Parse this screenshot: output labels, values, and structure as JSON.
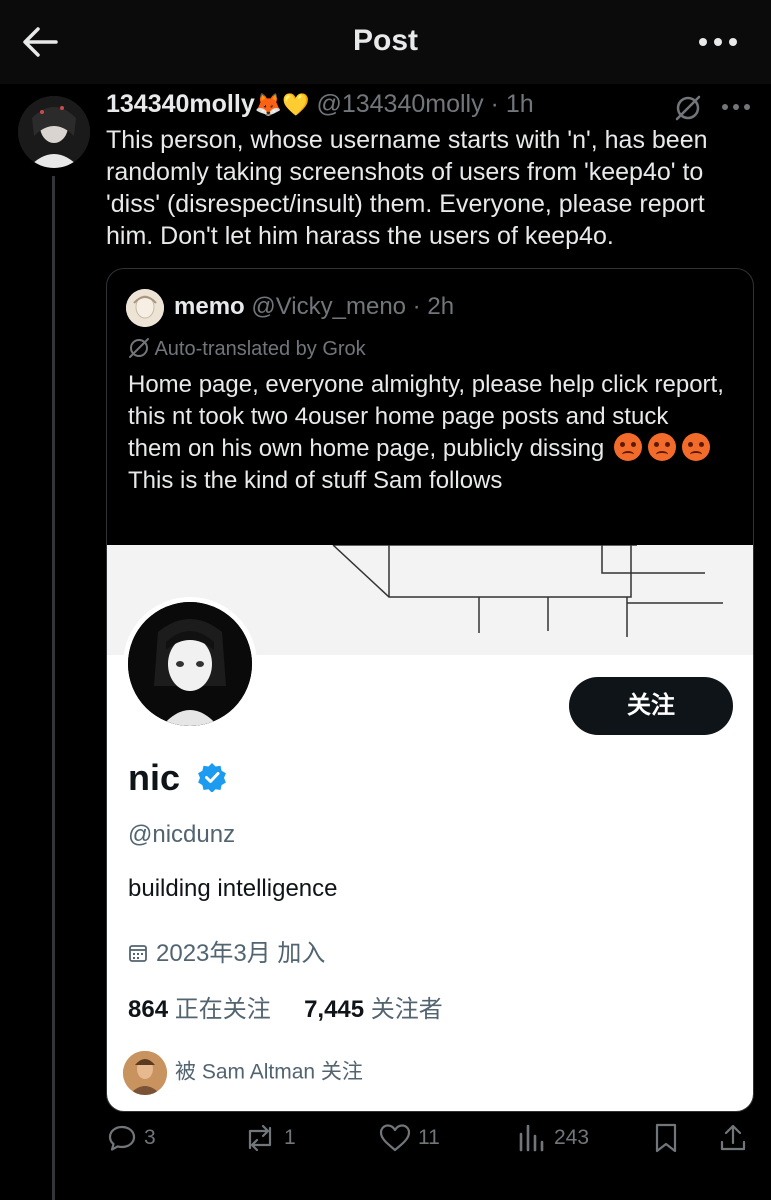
{
  "header": {
    "title": "Post",
    "back_icon": "arrow-left-icon",
    "more_icon": "more-horizontal-icon"
  },
  "post": {
    "author_name": "134340molly",
    "author_emojis": "🦊💛",
    "handle": "@134340molly",
    "time": "1h",
    "text": "This person, whose username starts with 'n', has been randomly taking screenshots of users from 'keep4o' to 'diss' (disrespect/insult) them. Everyone, please report him. Don't let him harass the users of keep4o.",
    "quote": {
      "name": "memo",
      "handle": "@Vicky_meno",
      "time": "2h",
      "translated_label": "Auto-translated by Grok",
      "text_before_emojis": "Home page, everyone almighty, please help click report, this nt took two 4ouser home page posts and stuck them on his own home page, publicly dissing",
      "text_after_emojis": "This is the kind of stuff Sam follows",
      "embedded_profile": {
        "display_name": "nic",
        "handle": "@nicdunz",
        "bio": "building intelligence",
        "joined": "2023年3月 加入",
        "following_count": "864",
        "following_label": "正在关注",
        "followers_count": "7,445",
        "followers_label": "关注者",
        "follow_button": "关注",
        "followed_by": "被 Sam Altman 关注"
      }
    }
  },
  "actions": {
    "replies": "3",
    "reposts": "1",
    "likes": "11",
    "views": "243"
  },
  "colors": {
    "background": "#000000",
    "text": "#e7e9ea",
    "muted": "#71767b",
    "verified": "#1d9bf0",
    "follow_button": "#0f1419"
  }
}
